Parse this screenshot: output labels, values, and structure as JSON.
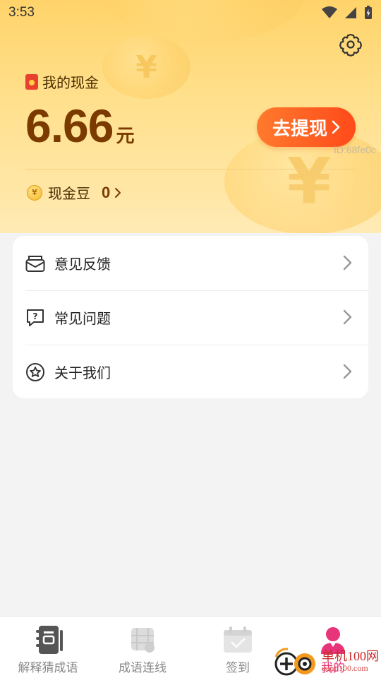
{
  "statusbar": {
    "time": "3:53"
  },
  "wallet": {
    "cash_label": "我的现金",
    "amount": "6.66",
    "unit": "元",
    "withdraw_button": "去提现",
    "id_text": "ID:68fe0c",
    "beans_label": "现金豆",
    "beans_value": "0"
  },
  "menu": {
    "items": [
      {
        "label": "意见反馈",
        "icon": "feedback-envelope-icon"
      },
      {
        "label": "常见问题",
        "icon": "faq-question-icon"
      },
      {
        "label": "关于我们",
        "icon": "about-star-icon"
      }
    ]
  },
  "tabbar": {
    "tabs": [
      {
        "label": "解释猜成语",
        "icon": "notebook-icon",
        "active": false
      },
      {
        "label": "成语连线",
        "icon": "film-icon",
        "active": false
      },
      {
        "label": "签到",
        "icon": "calendar-check-icon",
        "active": false
      },
      {
        "label": "我的",
        "icon": "profile-person-icon",
        "active": true
      }
    ]
  },
  "watermark": {
    "line1": "单机100网",
    "line2": "danji100.com"
  },
  "colors": {
    "accent_orange": "#ff5a1f",
    "amount_brown": "#7a3a00",
    "active_tab": "#e8347a"
  }
}
